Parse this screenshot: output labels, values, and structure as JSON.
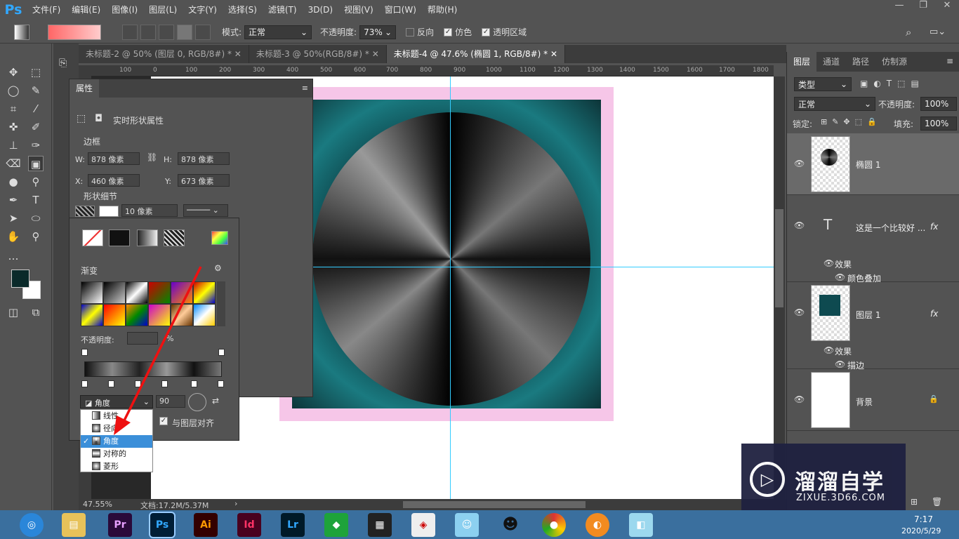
{
  "app": {
    "logo": "Ps",
    "window_controls": [
      "—",
      "❐",
      "✕"
    ]
  },
  "menu": [
    "文件(F)",
    "编辑(E)",
    "图像(I)",
    "图层(L)",
    "文字(Y)",
    "选择(S)",
    "滤镜(T)",
    "3D(D)",
    "视图(V)",
    "窗口(W)",
    "帮助(H)"
  ],
  "options": {
    "mode_label": "模式:",
    "mode_value": "正常",
    "opacity_label": "不透明度:",
    "opacity_value": "73%",
    "reverse": "反向",
    "dither": "仿色",
    "transparency": "透明区域"
  },
  "tabs": [
    "未标题-2 @ 50% (图层 0, RGB/8#) *",
    "未标题-3 @ 50%(RGB/8#) *",
    "未标题-4 @ 47.6% (椭圆 1, RGB/8#) *"
  ],
  "ruler": [
    "100",
    "0",
    "100",
    "200",
    "300",
    "400",
    "500",
    "600",
    "700",
    "800",
    "900",
    "1000",
    "1100",
    "1200",
    "1300",
    "1400",
    "1500",
    "1600",
    "1700",
    "1800"
  ],
  "properties": {
    "tab": "属性",
    "subtitle": "实时形状属性",
    "section_border": "边框",
    "w_label": "W:",
    "w_value": "878 像素",
    "h_label": "H:",
    "h_value": "878 像素",
    "x_label": "X:",
    "x_value": "460 像素",
    "y_label": "Y:",
    "y_value": "673 像素",
    "section_shape": "形状细节",
    "stroke_size": "10 像素"
  },
  "gradient_picker": {
    "title": "渐变",
    "opacity_label": "不透明度:",
    "opacity_unit": "%",
    "style_value": "角度",
    "angle_value": "90",
    "align_label": "与图层对齐"
  },
  "dropdown": {
    "items": [
      "线性",
      "径向",
      "角度",
      "对称的",
      "菱形"
    ],
    "selected": "角度"
  },
  "status": {
    "zoom": "47.55%",
    "doc": "文档:17.2M/5.37M"
  },
  "layers": {
    "tabs": [
      "图层",
      "通道",
      "路径",
      "仿制源"
    ],
    "filter": "类型",
    "blend": "正常",
    "opacity_label": "不透明度:",
    "opacity_value": "100%",
    "lock_label": "锁定:",
    "fill_label": "填充:",
    "fill_value": "100%",
    "items": [
      {
        "name": "椭圆 1"
      },
      {
        "name": "这是一个比较好 ...",
        "fx": "fx",
        "effects": "效果",
        "effect": "颜色叠加"
      },
      {
        "name": "图层 1",
        "fx": "fx",
        "effects": "效果",
        "effect": "描边"
      },
      {
        "name": "背景"
      }
    ]
  },
  "watermark": {
    "title": "溜溜自学",
    "url": "ZIXUE.3D66.COM"
  },
  "taskbar": {
    "apps": [
      "Pr",
      "Ps",
      "Ai",
      "Id",
      "Lr"
    ],
    "time": "7:17",
    "date": "2020/5/29"
  },
  "colors": {
    "accent": "#31a8ff",
    "guide": "#33ccff",
    "pink": "#f6c6e8",
    "teal": "#0e4a50"
  }
}
